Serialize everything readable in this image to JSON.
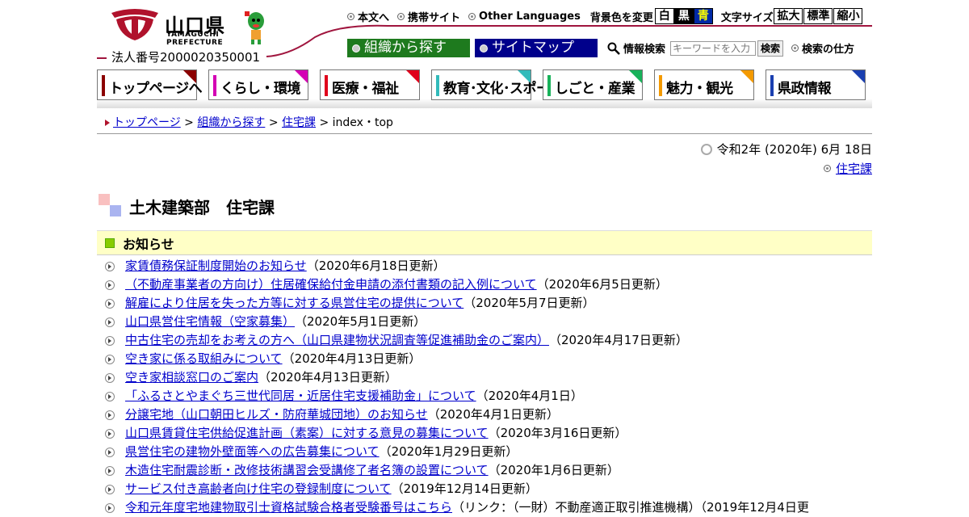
{
  "header": {
    "logo_name": "山口県",
    "logo_en_1": "YAMAGUCHI",
    "logo_en_2": "PREFECTURE",
    "corporate_number": "法人番号2000020350001",
    "top_links": [
      "本文へ",
      "携帯サイト",
      "Other Languages"
    ],
    "bgcolor_label": "背景色を変更",
    "bgcolor_options": [
      "白",
      "黒",
      "青"
    ],
    "fontsize_label": "文字サイズ",
    "fontsize_options": [
      "拡大",
      "標準",
      "縮小"
    ],
    "org_search_button": "組織から探す",
    "sitemap_button": "サイトマップ",
    "search_label": "情報検索",
    "search_placeholder": "キーワードを入力",
    "search_button": "検索",
    "search_howto": "検索の仕方"
  },
  "nav": [
    {
      "label": "トップページへ",
      "color": "#8b0000"
    },
    {
      "label": "くらし・環境",
      "color": "#d400b4"
    },
    {
      "label": "医療・福祉",
      "color": "#e0001b"
    },
    {
      "label": "教育･文化･スポーツ",
      "color": "#33bbbb"
    },
    {
      "label": "しごと・産業",
      "color": "#18b25a"
    },
    {
      "label": "魅力・観光",
      "color": "#f49a00"
    },
    {
      "label": "県政情報",
      "color": "#1a3fb0"
    }
  ],
  "breadcrumb": {
    "items": [
      "トップページ",
      "組織から探す",
      "住宅課"
    ],
    "current": "index・top"
  },
  "date_text": "令和2年 (2020年) 6月 18日",
  "dept_link": "住宅課",
  "page_title": "土木建築部　住宅課",
  "notice_heading": "お知らせ",
  "news": [
    {
      "title": "家賃債務保証制度開始のお知らせ",
      "note": "（2020年6月18日更新）"
    },
    {
      "title": "（不動産事業者の方向け）住居確保給付金申請の添付書類の記入例について",
      "note": "（2020年6月5日更新）"
    },
    {
      "title": "解雇により住居を失った方等に対する県営住宅の提供について",
      "note": "（2020年5月7日更新）"
    },
    {
      "title": "山口県営住宅情報（空家募集）",
      "note": "（2020年5月1日更新）"
    },
    {
      "title": "中古住宅の売却をお考えの方へ（山口県建物状況調査等促進補助金のご案内）",
      "note": "（2020年4月17日更新）"
    },
    {
      "title": "空き家に係る取組みについて",
      "note": "（2020年4月13日更新）"
    },
    {
      "title": "空き家相談窓口のご案内",
      "note": "（2020年4月13日更新）"
    },
    {
      "title": "「ふるさとやまぐち三世代同居・近居住宅支援補助金」について",
      "note": "（2020年4月1日）"
    },
    {
      "title": "分譲宅地（山口朝田ヒルズ・防府華城団地）のお知らせ",
      "note": "（2020年4月1日更新）"
    },
    {
      "title": "山口県賃貸住宅供給促進計画（素案）に対する意見の募集について",
      "note": "（2020年3月16日更新）"
    },
    {
      "title": "県営住宅の建物外壁面等への広告募集について",
      "note": "（2020年1月29日更新）"
    },
    {
      "title": "木造住宅耐震診断・改修技術講習会受講修了者名簿の設置について",
      "note": "（2020年1月6日更新）"
    },
    {
      "title": "サービス付き高齢者向け住宅の登録制度について",
      "note": "（2019年12月14日更新）"
    },
    {
      "title": "令和元年度宅地建物取引士資格試験合格者受験番号はこちら",
      "note": "（リンク：（一財）不動産適正取引推進機構）（2019年12月4日更"
    }
  ]
}
